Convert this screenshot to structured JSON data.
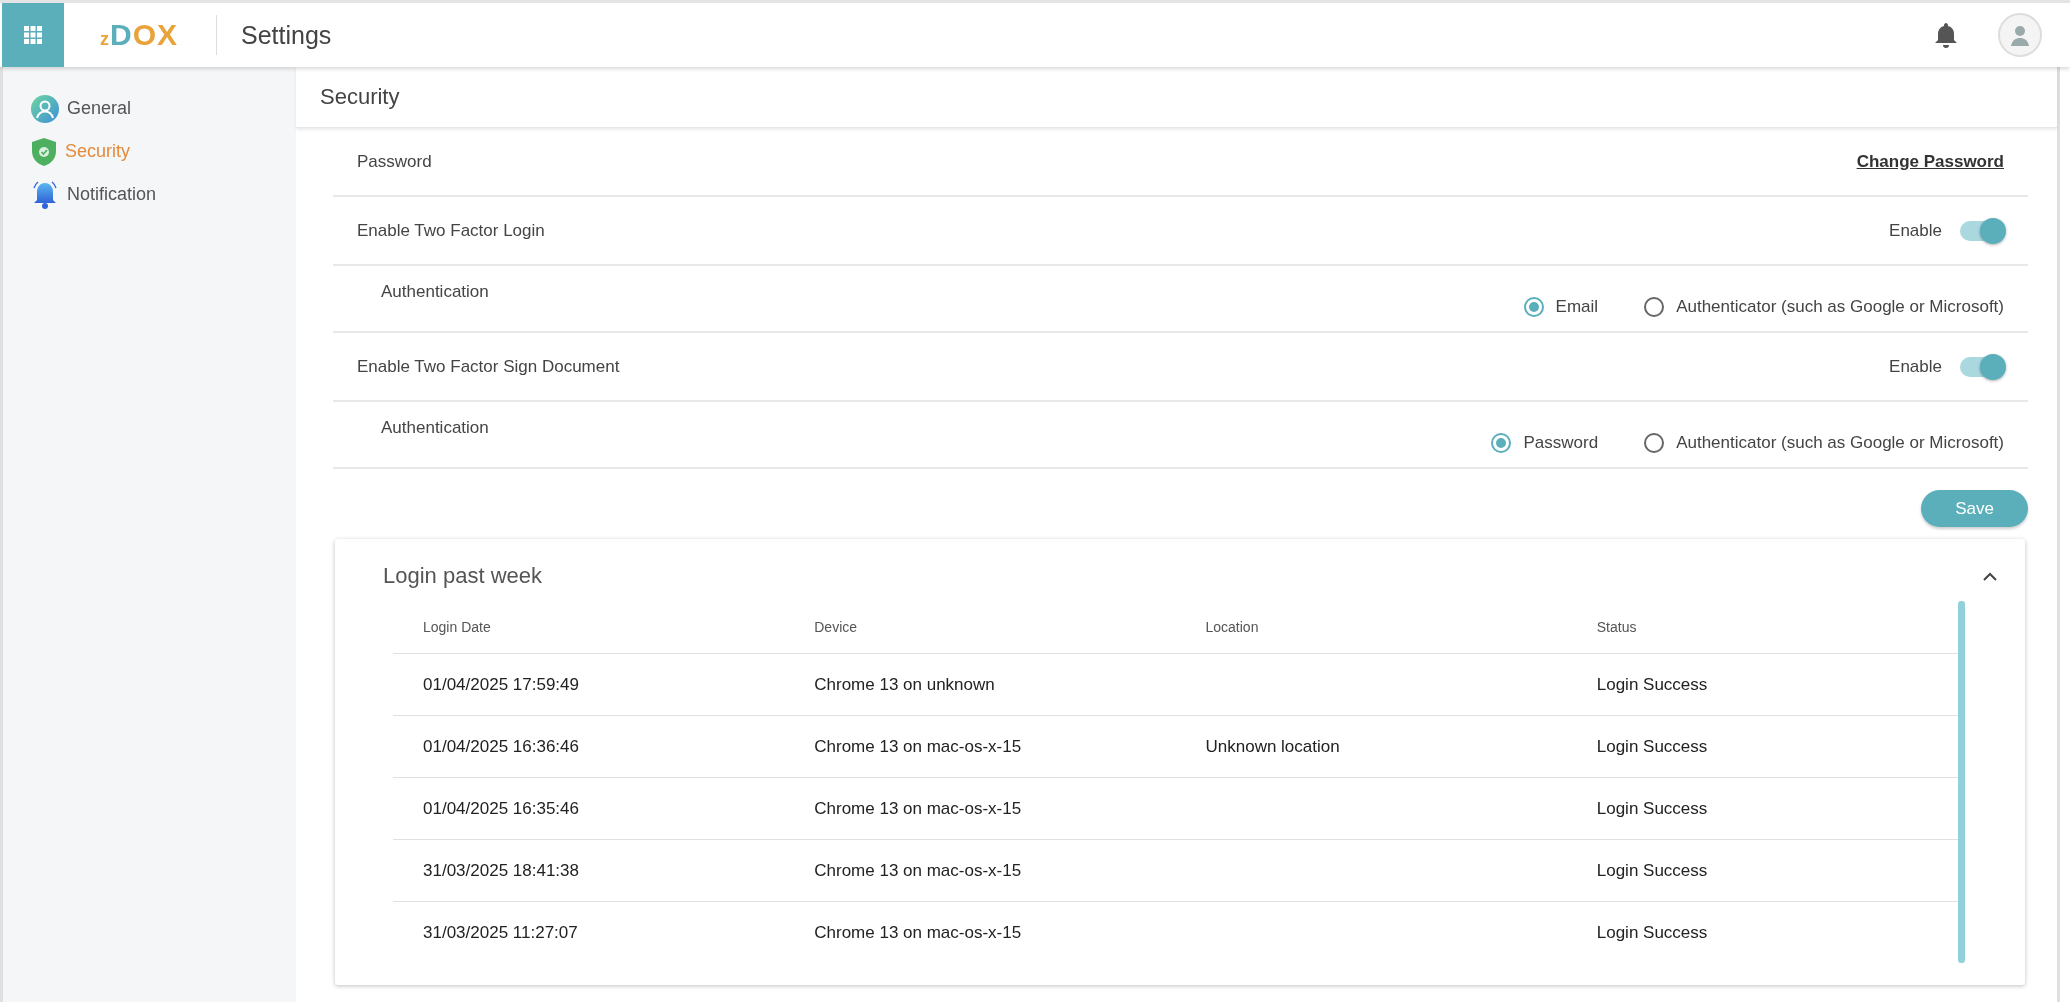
{
  "header": {
    "logo": "zDOX",
    "title": "Settings"
  },
  "sidebar": {
    "items": [
      {
        "label": "General",
        "selected": false
      },
      {
        "label": "Security",
        "selected": true
      },
      {
        "label": "Notification",
        "selected": false
      }
    ]
  },
  "page_title": "Security",
  "settings": [
    {
      "kind": "link",
      "label": "Password",
      "action": "Change Password"
    },
    {
      "kind": "toggle",
      "label": "Enable Two Factor Login",
      "toggle_label": "Enable",
      "on": true
    },
    {
      "kind": "radio",
      "label": "Authentication",
      "options": [
        {
          "label": "Email",
          "selected": true
        },
        {
          "label": "Authenticator (such as Google or Microsoft)",
          "selected": false
        }
      ]
    },
    {
      "kind": "toggle",
      "label": "Enable Two Factor Sign Document",
      "toggle_label": "Enable",
      "on": true
    },
    {
      "kind": "radio",
      "label": "Authentication",
      "options": [
        {
          "label": "Password",
          "selected": true
        },
        {
          "label": "Authenticator (such as Google or Microsoft)",
          "selected": false
        }
      ]
    }
  ],
  "save_button": "Save",
  "login_card": {
    "title": "Login past week",
    "expanded": true,
    "columns": [
      "Login Date",
      "Device",
      "Location",
      "Status"
    ],
    "rows": [
      [
        "01/04/2025 17:59:49",
        "Chrome 13 on unknown",
        "",
        "Login Success"
      ],
      [
        "01/04/2025 16:36:46",
        "Chrome 13 on mac-os-x-15",
        "Unknown location",
        "Login Success"
      ],
      [
        "01/04/2025 16:35:46",
        "Chrome 13 on mac-os-x-15",
        "",
        "Login Success"
      ],
      [
        "31/03/2025 18:41:38",
        "Chrome 13 on mac-os-x-15",
        "",
        "Login Success"
      ],
      [
        "31/03/2025 11:27:07",
        "Chrome 13 on mac-os-x-15",
        "",
        "Login Success"
      ]
    ]
  }
}
